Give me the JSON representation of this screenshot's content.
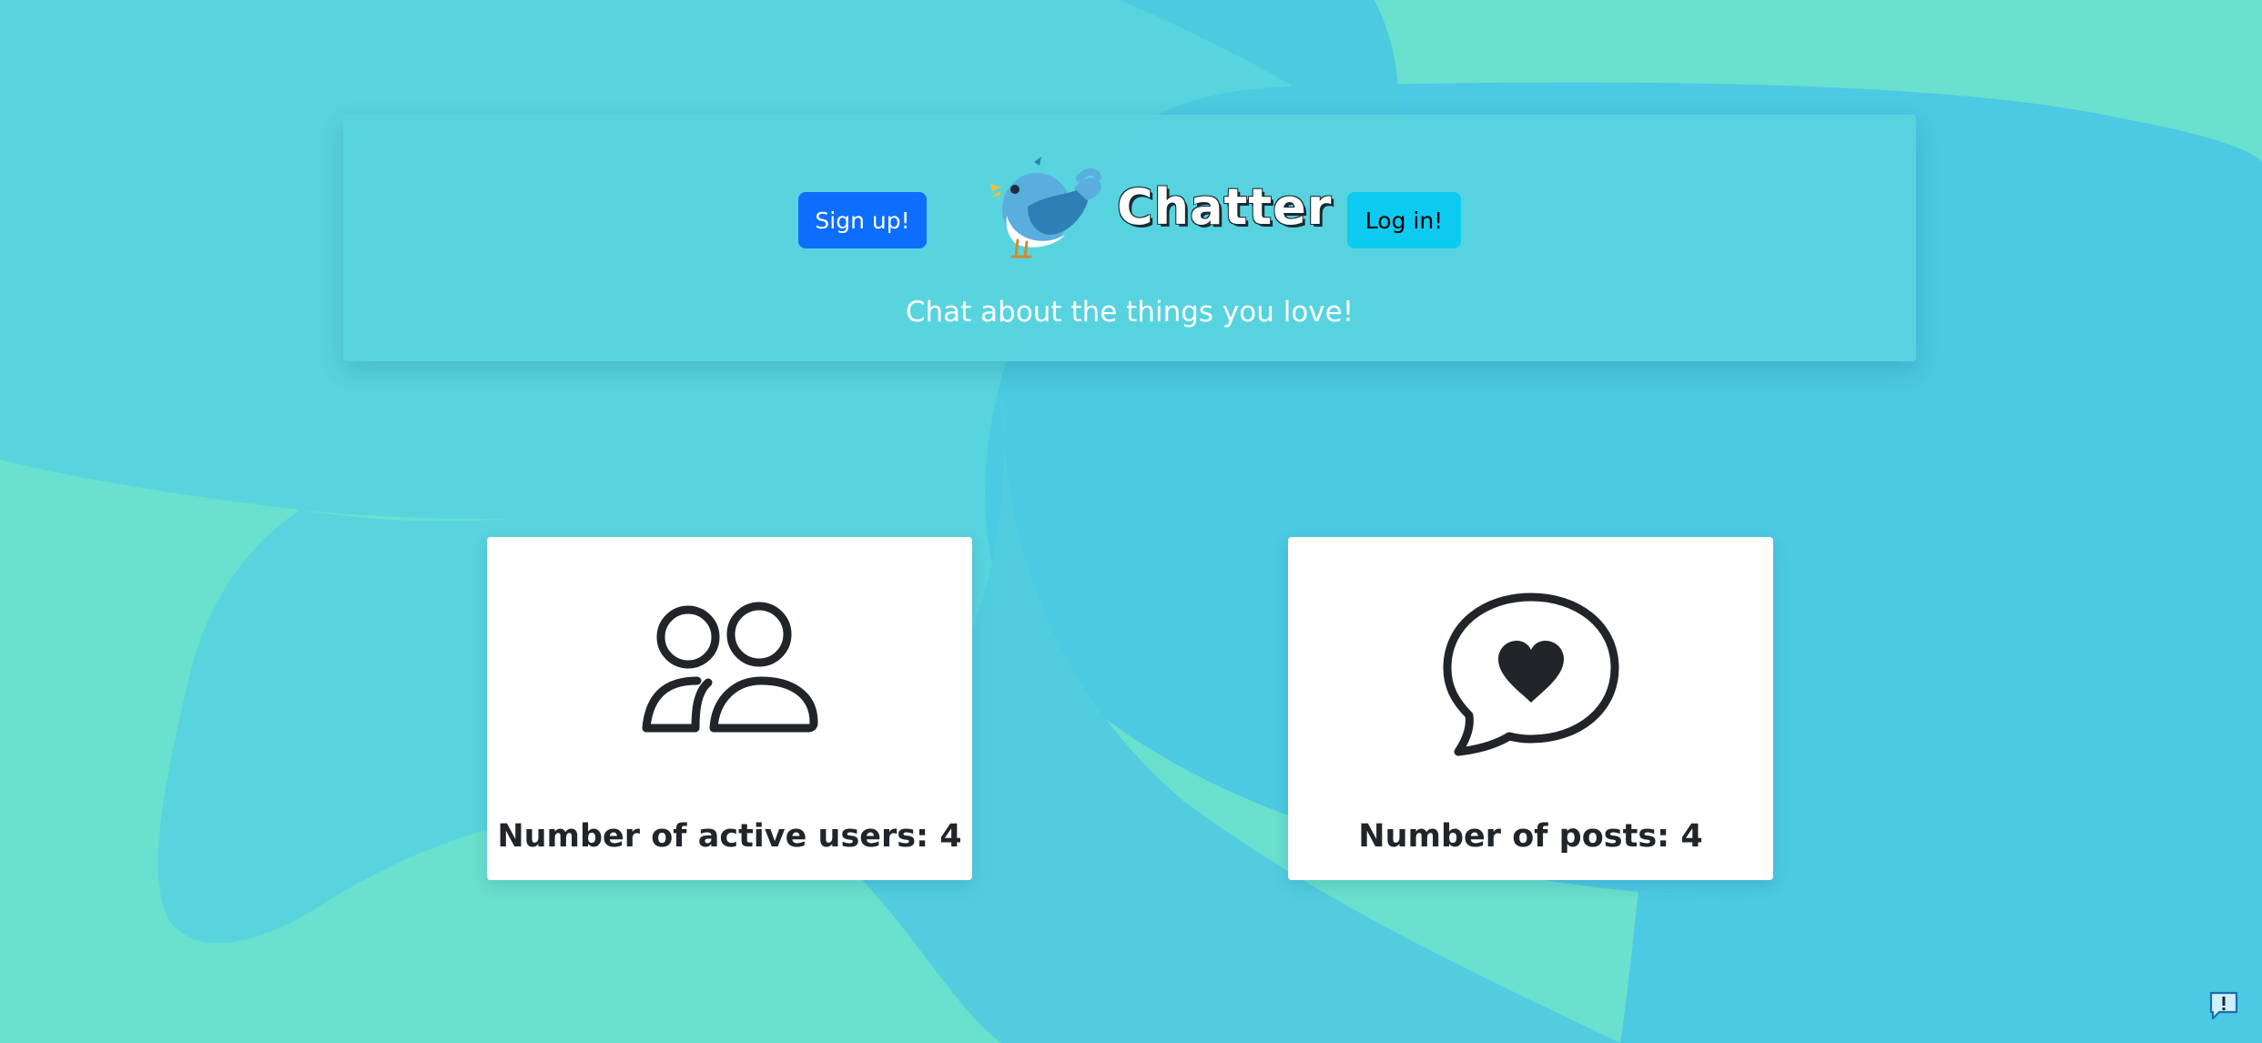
{
  "header": {
    "title": "Chatter",
    "tagline": "Chat about the things you love!",
    "logo_icon": "bird-icon",
    "signup_label": "Sign up!",
    "login_label": "Log in!"
  },
  "stats": {
    "users": {
      "label": "Number of active users: 4",
      "icon": "people-icon"
    },
    "posts": {
      "label": "Number of posts: 4",
      "icon": "chat-heart-icon"
    }
  },
  "feedback": {
    "icon": "feedback-icon"
  },
  "colors": {
    "background": "#6ae0ce",
    "hero": "#58d4de",
    "primary": "#0d6efd",
    "info": "#0dcaf0",
    "dark_text": "#212529"
  }
}
